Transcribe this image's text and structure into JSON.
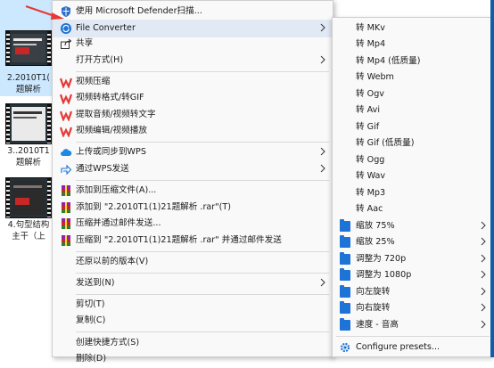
{
  "explorer": {
    "files": [
      {
        "label_line1": "2.2010T1(",
        "label_line2": "题解析"
      },
      {
        "label_line1": "3..2010T1",
        "label_line2": "题解析"
      },
      {
        "label_line1": "4.句型结构",
        "label_line2": "主干（上"
      }
    ]
  },
  "menu": {
    "items": [
      {
        "label": "使用 Microsoft Defender扫描...",
        "icon": "defender-shield-icon"
      },
      {
        "label": "File Converter",
        "icon": "file-converter-icon",
        "submenu": true
      },
      {
        "label": "共享",
        "icon": "share-icon"
      },
      {
        "label": "打开方式(H)",
        "submenu": true
      },
      {
        "label": "视频压缩",
        "icon": "wps-icon"
      },
      {
        "label": "视频转格式/转GIF",
        "icon": "wps-icon"
      },
      {
        "label": "提取音频/视频转文字",
        "icon": "wps-icon"
      },
      {
        "label": "视频编辑/视频播放",
        "icon": "wps-icon"
      },
      {
        "label": "上传或同步到WPS",
        "icon": "cloud-icon",
        "submenu": true
      },
      {
        "label": "通过WPS发送",
        "icon": "send-icon",
        "submenu": true
      },
      {
        "label": "添加到压缩文件(A)...",
        "icon": "winrar-icon"
      },
      {
        "label": "添加到 \"2.2010T1(1)21题解析  .rar\"(T)",
        "icon": "winrar-icon"
      },
      {
        "label": "压缩并通过邮件发送...",
        "icon": "winrar-icon"
      },
      {
        "label": "压缩到 \"2.2010T1(1)21题解析  .rar\" 并通过邮件发送",
        "icon": "winrar-icon"
      },
      {
        "label": "还原以前的版本(V)"
      },
      {
        "label": "发送到(N)",
        "submenu": true
      },
      {
        "label": "剪切(T)"
      },
      {
        "label": "复制(C)"
      },
      {
        "label": "创建快捷方式(S)"
      },
      {
        "label": "删除(D)"
      }
    ]
  },
  "submenu": {
    "items": [
      {
        "label": "转 MKv"
      },
      {
        "label": "转 Mp4"
      },
      {
        "label": "转 Mp4 (低质量)"
      },
      {
        "label": "转 Webm"
      },
      {
        "label": "转 Ogv"
      },
      {
        "label": "转 Avi"
      },
      {
        "label": "转 Gif"
      },
      {
        "label": "转 Gif (低质量)"
      },
      {
        "label": "转 Ogg"
      },
      {
        "label": "转 Wav"
      },
      {
        "label": "转 Mp3"
      },
      {
        "label": "转 Aac"
      },
      {
        "label": "缩放 75%",
        "folder": true,
        "submenu": true
      },
      {
        "label": "缩放 25%",
        "folder": true,
        "submenu": true
      },
      {
        "label": "调整为 720p",
        "folder": true,
        "submenu": true
      },
      {
        "label": "调整为 1080p",
        "folder": true,
        "submenu": true
      },
      {
        "label": "向左旋转",
        "folder": true,
        "submenu": true
      },
      {
        "label": "向右旋转",
        "folder": true,
        "submenu": true
      },
      {
        "label": "速度 - 音高",
        "folder": true,
        "submenu": true
      },
      {
        "label": "Configure presets...",
        "icon": "gear-icon"
      }
    ]
  },
  "colors": {
    "highlight": "#e1e9f5",
    "selection": "#cce8ff",
    "wps_red": "#e53935",
    "folder_blue": "#1e73d6",
    "arrow_red": "#e53935"
  }
}
